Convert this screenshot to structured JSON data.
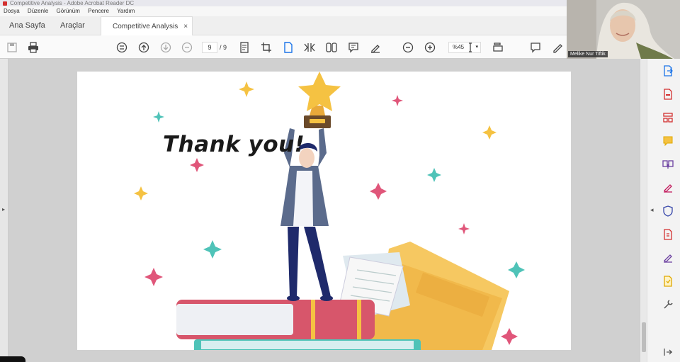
{
  "window": {
    "title": "Competitive Analysis - Adobe Acrobat Reader DC"
  },
  "menu": [
    "Dosya",
    "Düzenle",
    "Görünüm",
    "Pencere",
    "Yardım"
  ],
  "tabs": {
    "home": "Ana Sayfa",
    "tools": "Araçlar",
    "document": "Competitive Analysis",
    "close": "×"
  },
  "toolbar": {
    "page_current": "9",
    "page_total": "/ 9",
    "zoom": "%45",
    "icons": [
      "save-icon",
      "print-icon",
      "select-icon",
      "page-up-icon",
      "page-down-icon",
      "stop-icon",
      "fit-page-icon",
      "crop-icon",
      "single-page-icon",
      "scroll-icon",
      "two-page-icon",
      "comment-icon",
      "highlight-icon",
      "zoom-out-icon",
      "zoom-in-icon",
      "text-cursor-icon",
      "fit-width-icon",
      "sticky-note-icon",
      "pen-icon"
    ]
  },
  "slide": {
    "heading": "Thank you!"
  },
  "right_panel": {
    "icons": [
      "export-pdf-icon",
      "create-pdf-icon",
      "organize-pages-icon",
      "comment-icon",
      "combine-files-icon",
      "fill-sign-icon",
      "protect-icon",
      "compress-pdf-icon",
      "request-signature-icon",
      "send-review-icon",
      "more-tools-icon",
      "collapse-panel-icon"
    ]
  },
  "webcam": {
    "name": "Melike Nur Tiftik"
  },
  "colors": {
    "star_gold": "#f5c242",
    "pink": "#e0567a",
    "teal": "#4fc3b8",
    "shirt": "#5b6b8c",
    "pants": "#1f2a6b",
    "folder": "#f1b94b",
    "book_red": "#d7566b"
  }
}
